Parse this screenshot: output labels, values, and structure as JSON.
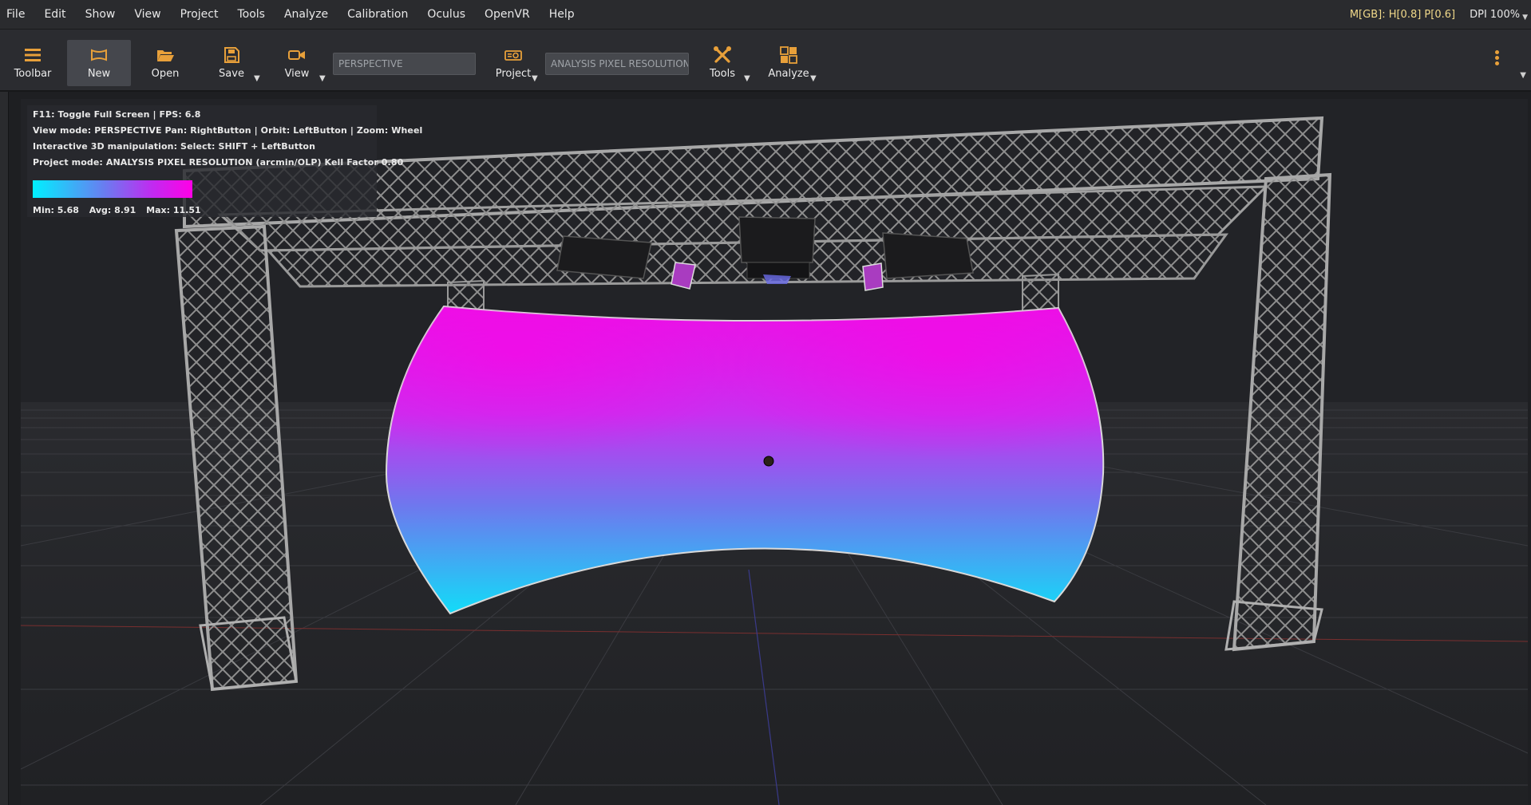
{
  "menu": [
    "File",
    "Edit",
    "Show",
    "View",
    "Project",
    "Tools",
    "Analyze",
    "Calibration",
    "Oculus",
    "OpenVR",
    "Help"
  ],
  "status": {
    "memory": "M[GB]: H[0.8] P[0.6]",
    "dpi": "DPI 100%"
  },
  "toolbar": {
    "toolbar_label": "Toolbar",
    "new_label": "New",
    "open_label": "Open",
    "save_label": "Save",
    "view_label": "View",
    "view_mode_field": "PERSPECTIVE",
    "project_label": "Project",
    "project_mode_field": "ANALYSIS PIXEL RESOLUTION",
    "tools_label": "Tools",
    "analyze_label": "Analyze"
  },
  "accent_color": "#e8a03a",
  "viewport": {
    "overlay_lines": [
      "F11: Toggle Full Screen | FPS: 6.8",
      "View mode: PERSPECTIVE Pan: RightButton | Orbit: LeftButton | Zoom: Wheel",
      "Interactive 3D manipulation: Select: SHIFT + LeftButton",
      "Project mode: ANALYSIS PIXEL RESOLUTION (arcmin/OLP) Kell Factor 0.80"
    ],
    "colorbar": {
      "from": "#00f0ff",
      "to": "#ff00e6"
    },
    "stats": {
      "min": "Min: 5.68",
      "avg": "Avg: 8.91",
      "max": "Max: 11.51"
    }
  }
}
